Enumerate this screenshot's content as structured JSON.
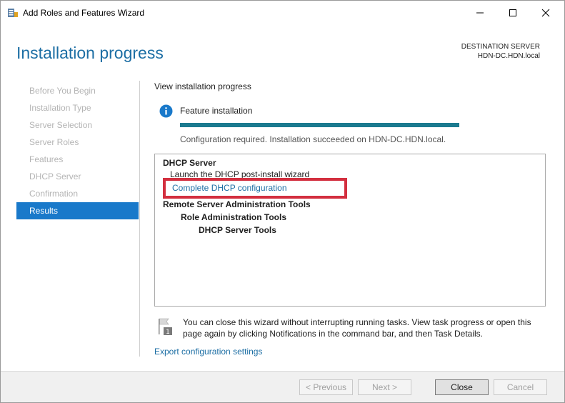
{
  "window": {
    "title": "Add Roles and Features Wizard"
  },
  "header": {
    "page_title": "Installation progress",
    "destination_label": "DESTINATION SERVER",
    "destination_server": "HDN-DC.HDN.local"
  },
  "sidebar": {
    "items": [
      {
        "label": "Before You Begin",
        "state": "disabled"
      },
      {
        "label": "Installation Type",
        "state": "disabled"
      },
      {
        "label": "Server Selection",
        "state": "disabled"
      },
      {
        "label": "Server Roles",
        "state": "disabled"
      },
      {
        "label": "Features",
        "state": "disabled"
      },
      {
        "label": "DHCP Server",
        "state": "disabled"
      },
      {
        "label": "Confirmation",
        "state": "disabled"
      },
      {
        "label": "Results",
        "state": "active"
      }
    ]
  },
  "content": {
    "view_label": "View installation progress",
    "feature_label": "Feature installation",
    "progress_percent": 100,
    "status_text": "Configuration required. Installation succeeded on HDN-DC.HDN.local.",
    "results": {
      "dhcp_server": "DHCP Server",
      "launch_text": "Launch the DHCP post-install wizard",
      "complete_link": "Complete DHCP configuration",
      "rsat": "Remote Server Administration Tools",
      "role_admin": "Role Administration Tools",
      "dhcp_tools": "DHCP Server Tools"
    },
    "note_text": "You can close this wizard without interrupting running tasks. View task progress or open this page again by clicking Notifications in the command bar, and then Task Details.",
    "export_link": "Export configuration settings"
  },
  "footer": {
    "previous": "< Previous",
    "next": "Next >",
    "close": "Close",
    "cancel": "Cancel"
  },
  "colors": {
    "accent": "#1979ca",
    "link": "#1c6ea4",
    "progress": "#1b7a8f",
    "highlight": "#d32f3f"
  },
  "icons": {
    "app": "server-manager-icon",
    "info": "info-icon",
    "flag": "notification-flag-icon"
  }
}
